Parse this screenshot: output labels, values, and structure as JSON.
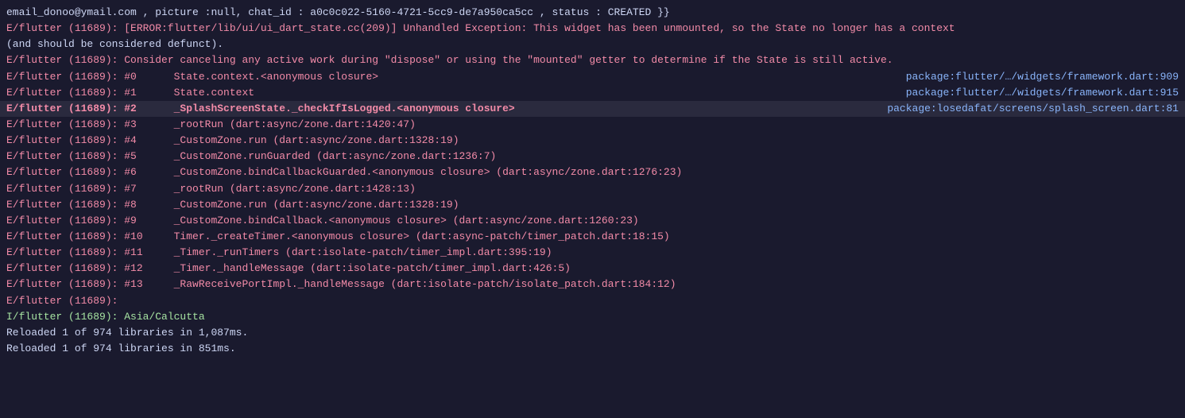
{
  "console": {
    "lines": [
      {
        "id": 1,
        "type": "normal",
        "content": "email_donoo@ymail.com , picture :null, chat_id : a0c0c022-5160-4721-5cc9-de7a950ca5cc , status : CREATED }}",
        "link": null,
        "bold": false,
        "highlight": false
      },
      {
        "id": 2,
        "type": "error",
        "content": "E/flutter (11689): [ERROR:flutter/lib/ui/ui_dart_state.cc(209)] Unhandled Exception: This widget has been unmounted, so the State no longer has a context",
        "link": null,
        "bold": false,
        "highlight": false
      },
      {
        "id": 3,
        "type": "normal",
        "content": "(and should be considered defunct).",
        "link": null,
        "bold": false,
        "highlight": false
      },
      {
        "id": 4,
        "type": "error",
        "content": "E/flutter (11689): Consider canceling any active work during \"dispose\" or using the \"mounted\" getter to determine if the State is still active.",
        "link": null,
        "bold": false,
        "highlight": false
      },
      {
        "id": 5,
        "type": "error",
        "content": "E/flutter (11689): #0      State.context.<anonymous closure>",
        "link": "package:flutter/…/widgets/framework.dart:909",
        "bold": false,
        "highlight": false
      },
      {
        "id": 6,
        "type": "error",
        "content": "E/flutter (11689): #1      State.context",
        "link": "package:flutter/…/widgets/framework.dart:915",
        "bold": false,
        "highlight": false
      },
      {
        "id": 7,
        "type": "error",
        "content": "E/flutter (11689): #2      _SplashScreenState._checkIfIsLogged.<anonymous closure>",
        "link": "package:losedafat/screens/splash_screen.dart:81",
        "bold": true,
        "highlight": true
      },
      {
        "id": 8,
        "type": "error",
        "content": "E/flutter (11689): #3      _rootRun (dart:async/zone.dart:1420:47)",
        "link": null,
        "bold": false,
        "highlight": false
      },
      {
        "id": 9,
        "type": "error",
        "content": "E/flutter (11689): #4      _CustomZone.run (dart:async/zone.dart:1328:19)",
        "link": null,
        "bold": false,
        "highlight": false
      },
      {
        "id": 10,
        "type": "error",
        "content": "E/flutter (11689): #5      _CustomZone.runGuarded (dart:async/zone.dart:1236:7)",
        "link": null,
        "bold": false,
        "highlight": false
      },
      {
        "id": 11,
        "type": "error",
        "content": "E/flutter (11689): #6      _CustomZone.bindCallbackGuarded.<anonymous closure> (dart:async/zone.dart:1276:23)",
        "link": null,
        "bold": false,
        "highlight": false
      },
      {
        "id": 12,
        "type": "error",
        "content": "E/flutter (11689): #7      _rootRun (dart:async/zone.dart:1428:13)",
        "link": null,
        "bold": false,
        "highlight": false
      },
      {
        "id": 13,
        "type": "error",
        "content": "E/flutter (11689): #8      _CustomZone.run (dart:async/zone.dart:1328:19)",
        "link": null,
        "bold": false,
        "highlight": false
      },
      {
        "id": 14,
        "type": "error",
        "content": "E/flutter (11689): #9      _CustomZone.bindCallback.<anonymous closure> (dart:async/zone.dart:1260:23)",
        "link": null,
        "bold": false,
        "highlight": false
      },
      {
        "id": 15,
        "type": "error",
        "content": "E/flutter (11689): #10     Timer._createTimer.<anonymous closure> (dart:async-patch/timer_patch.dart:18:15)",
        "link": null,
        "bold": false,
        "highlight": false
      },
      {
        "id": 16,
        "type": "error",
        "content": "E/flutter (11689): #11     _Timer._runTimers (dart:isolate-patch/timer_impl.dart:395:19)",
        "link": null,
        "bold": false,
        "highlight": false
      },
      {
        "id": 17,
        "type": "error",
        "content": "E/flutter (11689): #12     _Timer._handleMessage (dart:isolate-patch/timer_impl.dart:426:5)",
        "link": null,
        "bold": false,
        "highlight": false
      },
      {
        "id": 18,
        "type": "error",
        "content": "E/flutter (11689): #13     _RawReceivePortImpl._handleMessage (dart:isolate-patch/isolate_patch.dart:184:12)",
        "link": null,
        "bold": false,
        "highlight": false
      },
      {
        "id": 19,
        "type": "error",
        "content": "E/flutter (11689):",
        "link": null,
        "bold": false,
        "highlight": false
      },
      {
        "id": 20,
        "type": "info",
        "content": "I/flutter (11689): Asia/Calcutta",
        "link": null,
        "bold": false,
        "highlight": false
      },
      {
        "id": 21,
        "type": "normal",
        "content": "Reloaded 1 of 974 libraries in 1,087ms.",
        "link": null,
        "bold": false,
        "highlight": false
      },
      {
        "id": 22,
        "type": "normal",
        "content": "Reloaded 1 of 974 libraries in 851ms.",
        "link": null,
        "bold": false,
        "highlight": false
      }
    ]
  }
}
